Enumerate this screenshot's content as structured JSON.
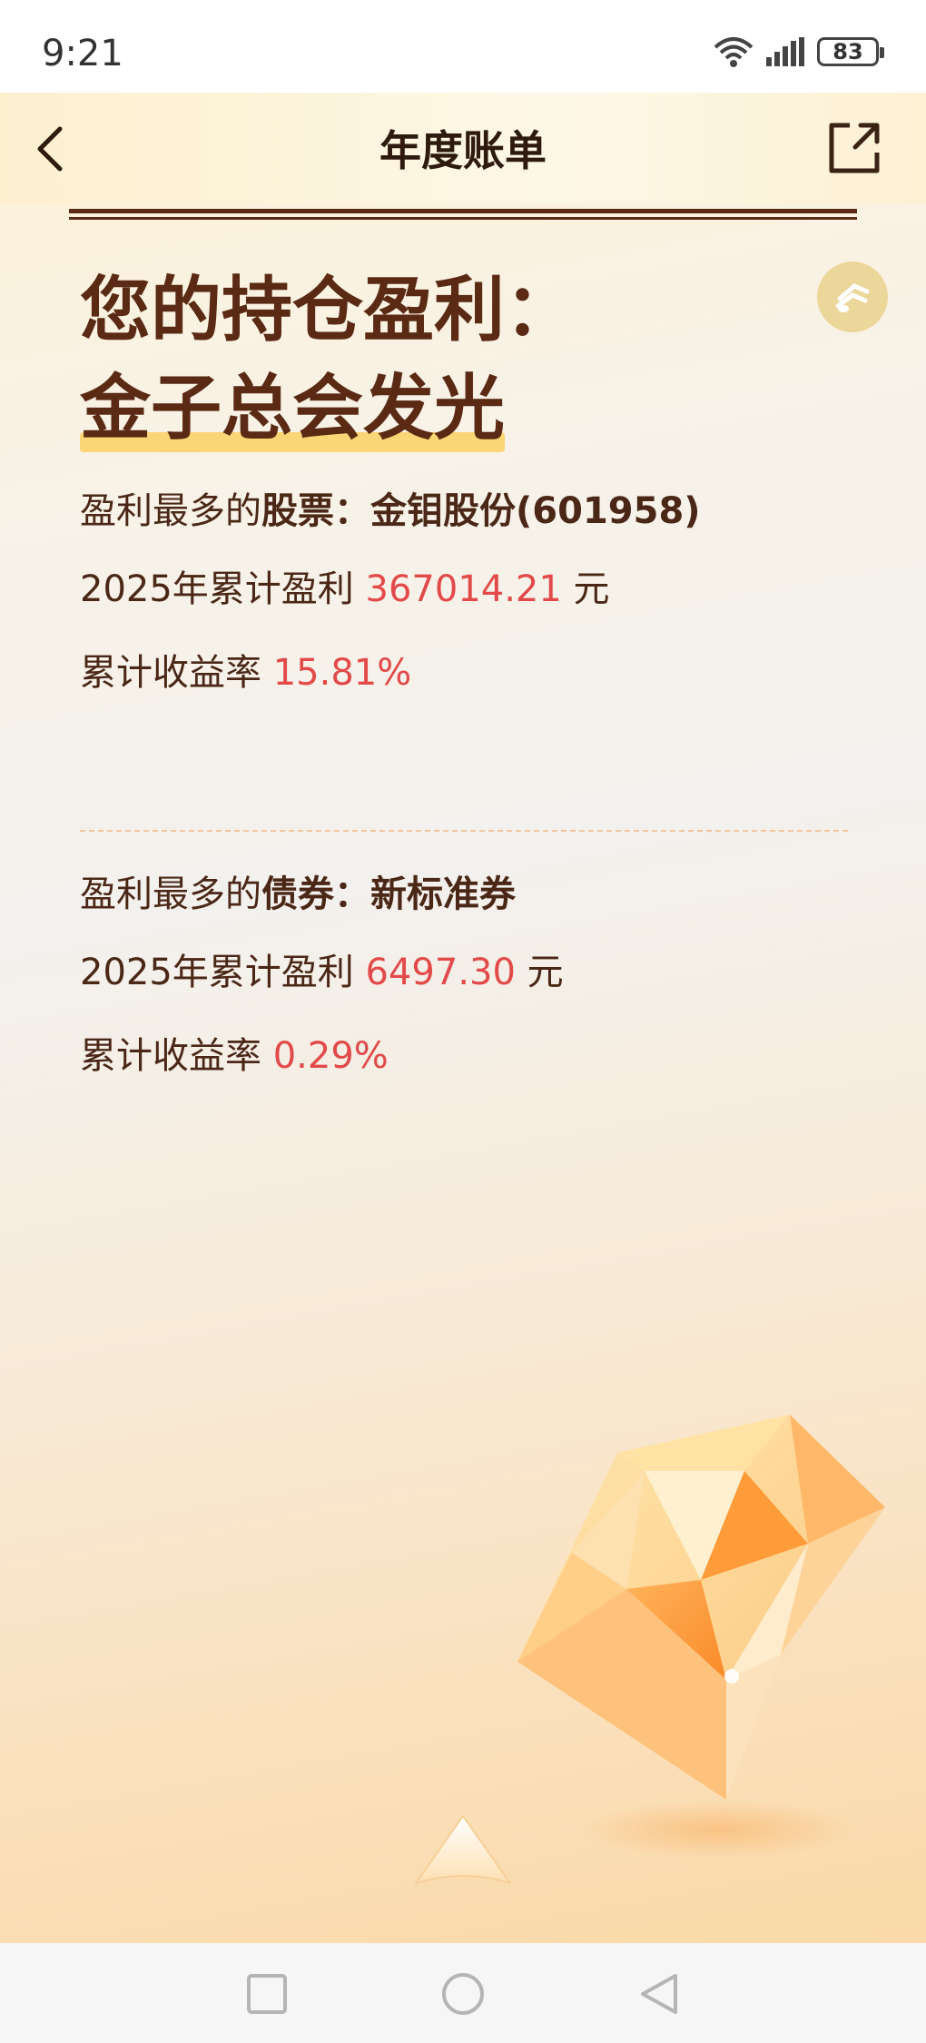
{
  "status_bar": {
    "time": "9:21",
    "battery": "83",
    "icons": [
      "wifi-icon",
      "signal-icon",
      "battery-icon"
    ]
  },
  "nav": {
    "title": "年度账单",
    "back_icon": "chevron-left-icon",
    "share_icon": "share-icon"
  },
  "music_icon": "music-note-icon",
  "headline": {
    "line1": "您的持仓盈利：",
    "line2": "金子总会发光"
  },
  "stock": {
    "label_prefix": "盈利最多的",
    "label_bold": "股票：",
    "name": "金钼股份(601958)",
    "profit_label": "2025年累计盈利",
    "profit_value": "367014.21",
    "profit_unit": "元",
    "rate_label": "累计收益率",
    "rate_value": "15.81%"
  },
  "bond": {
    "label_prefix": "盈利最多的",
    "label_bold": "债券：",
    "name": "新标准券",
    "profit_label": "2025年累计盈利",
    "profit_value": "6497.30",
    "profit_unit": "元",
    "rate_label": "累计收益率",
    "rate_value": "0.29%"
  },
  "colors": {
    "headline": "#5a2a14",
    "highlight": "#fcd676",
    "value_red": "#e24a4a",
    "text_dark": "#4a2716"
  },
  "system_nav": [
    "square-icon",
    "circle-icon",
    "triangle-back-icon"
  ]
}
